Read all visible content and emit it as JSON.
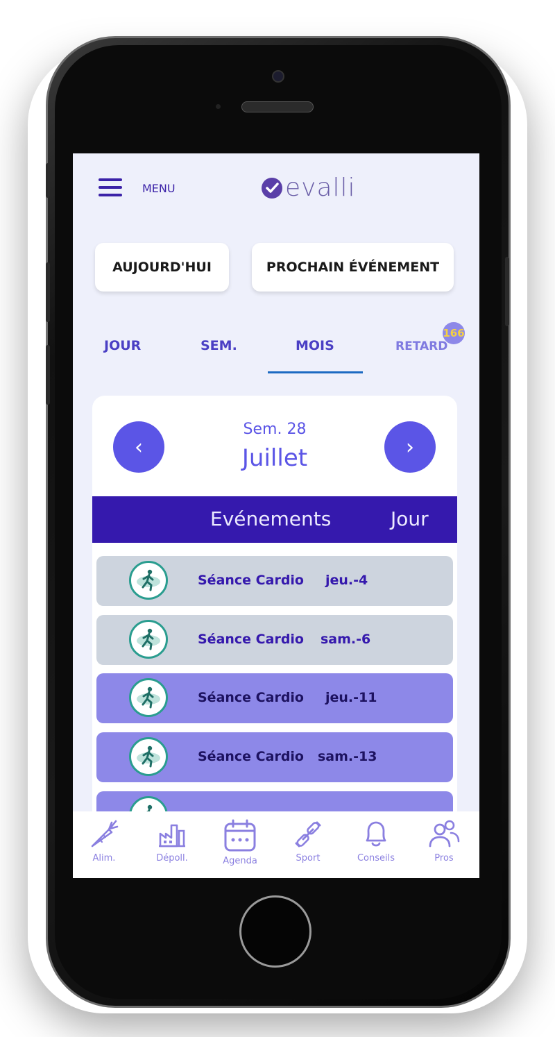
{
  "header": {
    "menu_label": "MENU",
    "logo_text": "evalli"
  },
  "quick_buttons": {
    "today": "AUJOURD'HUI",
    "next_event": "PROCHAIN ÉVÉNEMENT"
  },
  "tabs": [
    {
      "label": "JOUR"
    },
    {
      "label": "SEM."
    },
    {
      "label": "MOIS",
      "active": true
    },
    {
      "label": "RETARD",
      "badge": "166"
    }
  ],
  "calendar": {
    "prev": "‹",
    "next": "›",
    "week": "Sem. 28",
    "month": "Juillet",
    "col_events": "Evénements",
    "col_day": "Jour"
  },
  "events": [
    {
      "name": "Séance Cardio",
      "day": "jeu.-4",
      "color": "#cdd4de"
    },
    {
      "name": "Séance Cardio",
      "day": "sam.-6",
      "color": "#cdd4de"
    },
    {
      "name": "Séance Cardio",
      "day": "jeu.-11",
      "color": "#8d88e8"
    },
    {
      "name": "Séance Cardio",
      "day": "sam.-13",
      "color": "#8d88e8"
    },
    {
      "name": "",
      "day": "",
      "color": "#8d88e8"
    }
  ],
  "bottom_nav": [
    {
      "label": "Alim.",
      "icon": "carrot-icon"
    },
    {
      "label": "Dépoll.",
      "icon": "factory-icon"
    },
    {
      "label": "Agenda",
      "icon": "calendar-icon"
    },
    {
      "label": "Sport",
      "icon": "dumbbell-icon"
    },
    {
      "label": "Conseils",
      "icon": "bell-icon"
    },
    {
      "label": "Pros",
      "icon": "users-icon"
    }
  ],
  "colors": {
    "accent": "#5b55e6",
    "header_bg": "#3519ad",
    "past_row": "#cdd4de",
    "future_row": "#8d88e8",
    "screen_bg": "#eef0fb"
  }
}
